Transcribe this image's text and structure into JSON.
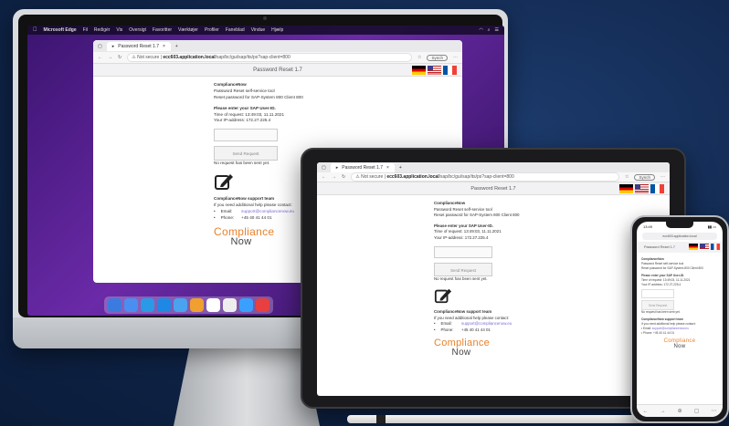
{
  "mac_menubar": {
    "app": "Microsoft Edge",
    "items": [
      "Fil",
      "Redigér",
      "Vis",
      "Oversigt",
      "Favoritter",
      "Værktøjer",
      "Profiler",
      "Faneblad",
      "Vindue",
      "Hjælp"
    ]
  },
  "browser": {
    "tab_title": "Password Reset 1.7",
    "new_tab": "+",
    "not_secure": "Not secure",
    "url_host": "ecc603.application.local",
    "url_path": "/sap/bc/gui/sap/its/ps?sap-client=800",
    "sync_label": "Synch"
  },
  "page": {
    "header_title": "Password Reset 1.7",
    "product": "ComplianceNow",
    "tool_desc": "Password Reset self-service tool",
    "reset_for": "Reset password for SAP-System 800 Client 800",
    "prompt": "Please enter your SAP User-ID.",
    "time_line": "Time of request: 13:49:03, 11.11.2021",
    "ip_line": "Your IP-address: 172.27.225.4",
    "button": "Send Request",
    "status": "No request has been sent yet.",
    "support_title": "ComplianceNow support team",
    "support_text": "If you need additional help please contact:",
    "email_label": "Email:",
    "email_value": "support@compliancenow.eu",
    "phone_label": "Phone:",
    "phone_value": "+45 40 41 44 01",
    "brand_top": "Compliance",
    "brand_bottom": "Now"
  },
  "phone": {
    "time": "13:49",
    "url": "ecc603.application.local",
    "header_title": "Password Reset 1.7"
  }
}
